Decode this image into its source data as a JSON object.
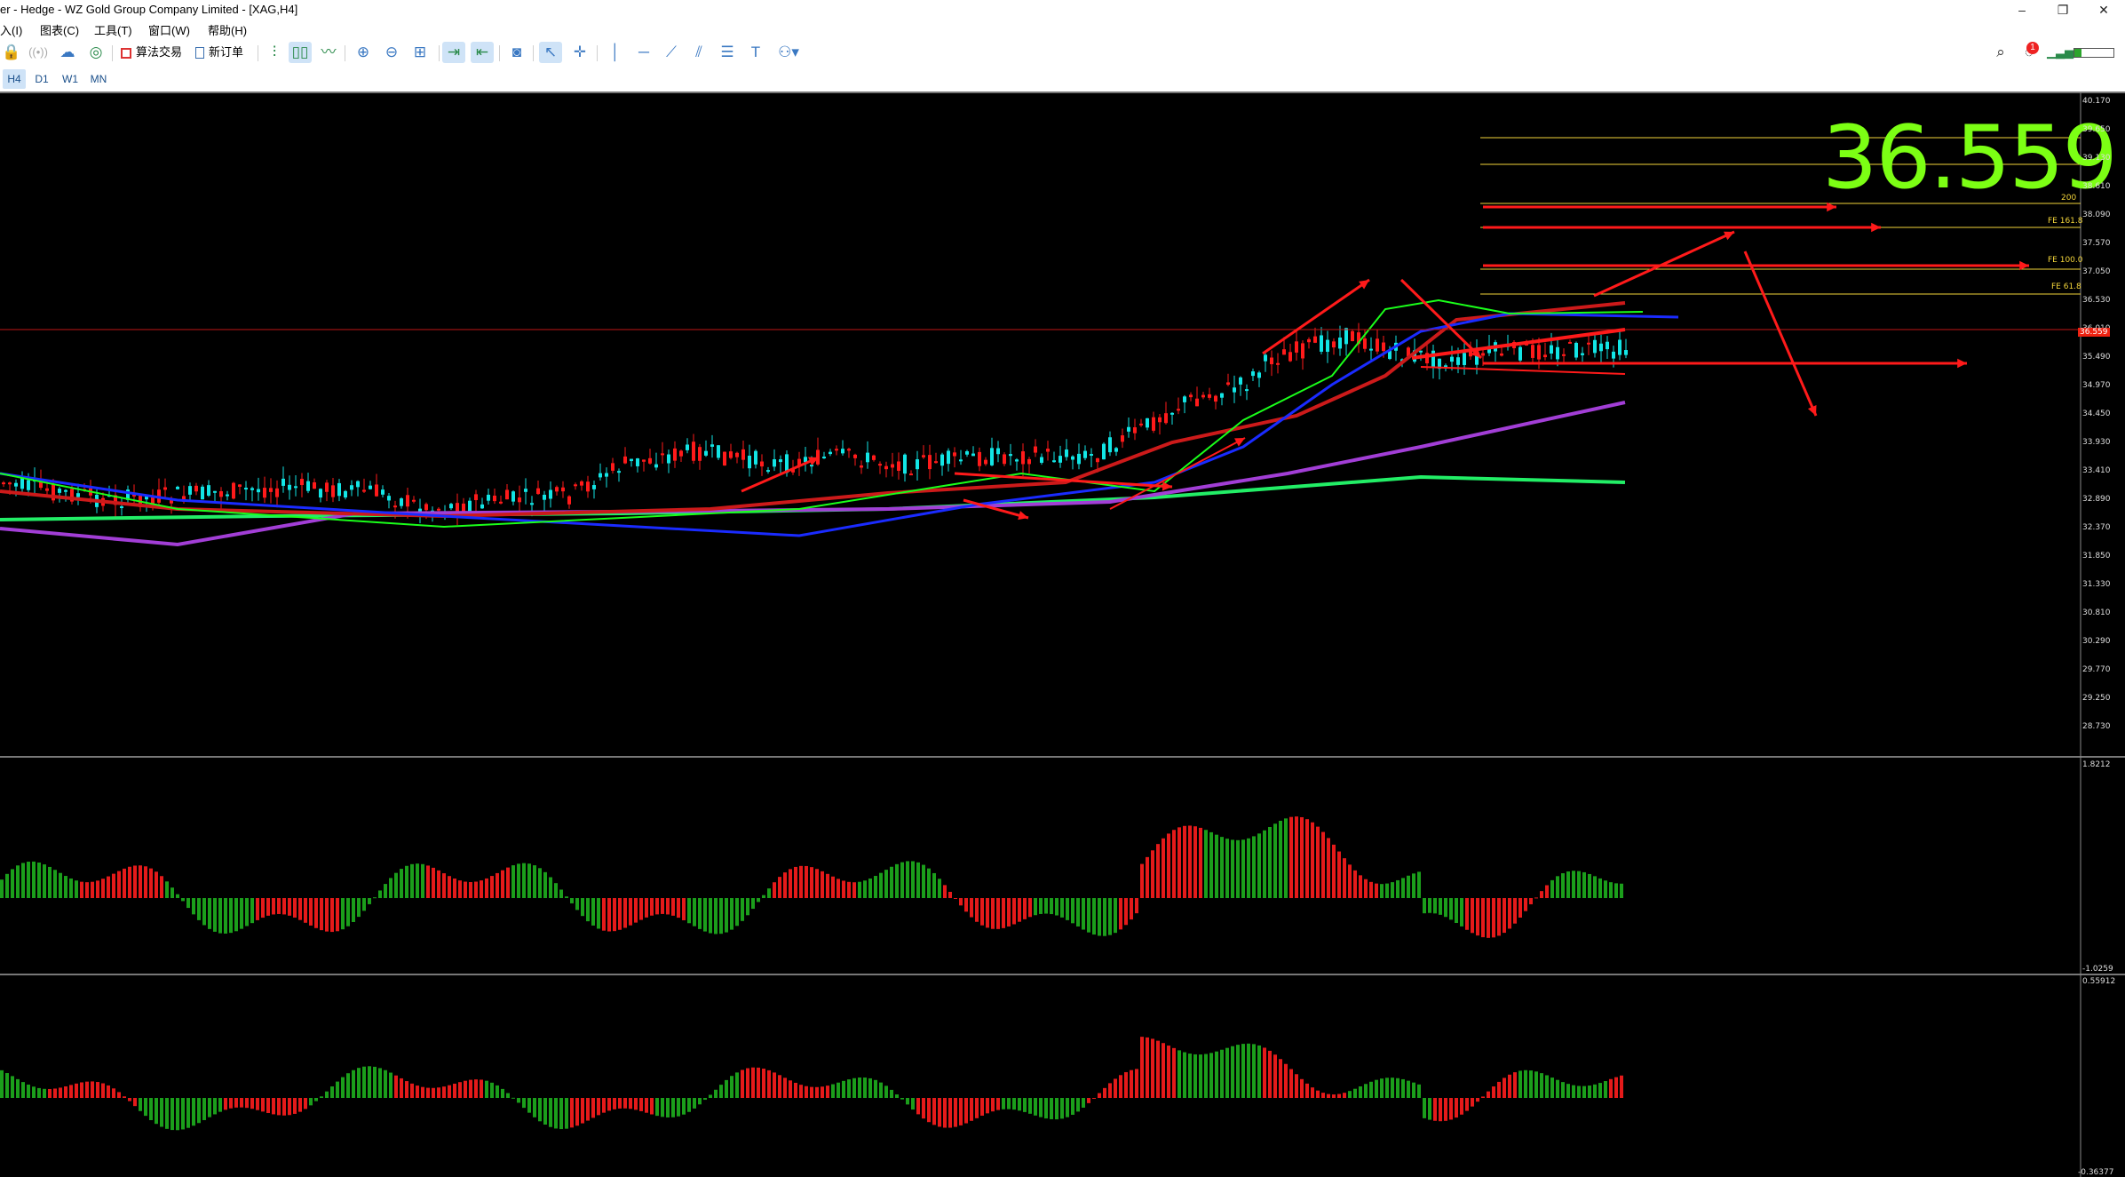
{
  "window": {
    "title": "er - Hedge - WZ Gold Group Company Limited - [XAG,H4]",
    "controls": [
      "–",
      "❐",
      "✕"
    ]
  },
  "menu": [
    "入(I)",
    "图表(C)",
    "工具(T)",
    "窗口(W)",
    "帮助(H)"
  ],
  "toolbar": {
    "algo_trading_label": "算法交易",
    "new_order_label": "新订单",
    "notification_count": "1"
  },
  "timeframes": [
    "H4",
    "D1",
    "W1",
    "MN"
  ],
  "active_timeframe": "H4",
  "chart": {
    "symbol": "XAG",
    "period": "H4",
    "current_price": "36.559",
    "price_tag": "36.559",
    "price_axis": [
      "40.170",
      "39.650",
      "39.130",
      "38.610",
      "38.090",
      "37.570",
      "37.050",
      "36.530",
      "36.010",
      "35.490",
      "34.970",
      "34.450",
      "33.930",
      "33.410",
      "32.890",
      "32.370",
      "31.850",
      "31.330",
      "30.810",
      "30.290",
      "29.770",
      "29.250",
      "28.730"
    ],
    "fib_labels": [
      "200",
      "FE 161.8",
      "FE 100.0",
      "FE 61.8"
    ],
    "macd_axis": {
      "top": "1.8212",
      "bottom": "-1.0259"
    },
    "osc_axis": {
      "top": "0.55912",
      "bottom": "-0.36377"
    },
    "colors": {
      "bull": "#12e5e5",
      "bear": "#ff1a1a",
      "hist_up": "#1b9e1b",
      "hist_down": "#e51a1a",
      "big_price": "#7cff14",
      "fib": "#f2d43a",
      "ma_fast": "#1aff1a",
      "ma_blue": "#1a2bff",
      "ma_purple": "#a23ed6",
      "ma_green_long": "#22ee66"
    }
  }
}
